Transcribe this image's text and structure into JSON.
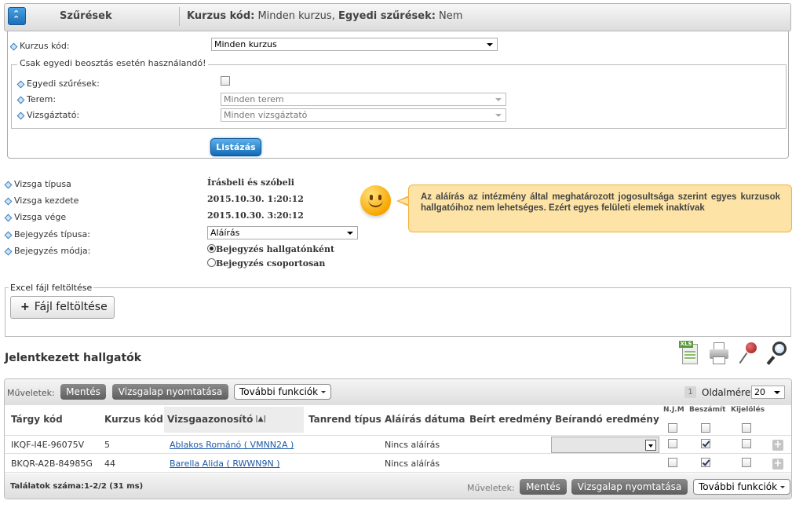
{
  "filter_header": {
    "title": "Szűrések",
    "summary_key1": "Kurzus kód:",
    "summary_val1": " Minden kurzus, ",
    "summary_key2": "Egyedi szűrések:",
    "summary_val2": " Nem"
  },
  "filters": {
    "kurzus_kod_label": "Kurzus kód:",
    "kurzus_kod_value": "Minden kurzus",
    "fieldset_legend": "Csak egyedi beosztás esetén használandó!",
    "egyedi_label": "Egyedi szűrések:",
    "terem_label": "Terem:",
    "terem_value": "Minden terem",
    "vizsgaztato_label": "Vizsgáztató:",
    "vizsgaztato_value": "Minden vizsgáztató",
    "list_button": "Listázás"
  },
  "exam": {
    "tipus_label": "Vizsga típusa",
    "tipus_value": "Írásbeli és szóbeli",
    "kezdete_label": "Vizsga kezdete",
    "kezdete_value": "2015.10.30. 1:20:12",
    "vege_label": "Vizsga vége",
    "vege_value": "2015.10.30. 3:20:12",
    "bejegyzes_tipus_label": "Bejegyzés típusa:",
    "bejegyzes_tipus_value": "Aláírás",
    "bejegyzes_mod_label": "Bejegyzés módja:",
    "radio1": "Bejegyzés hallgatónként",
    "radio2": "Bejegyzés csoportosan"
  },
  "notice": {
    "text": "Az aláírás az intézmény által meghatározott jogosultsága szerint egyes kurzusok hallgatóihoz nem lehetséges. Ezért egyes felületi elemek inaktívak"
  },
  "upload": {
    "legend": "Excel fájl feltöltése",
    "button": "Fájl feltöltése"
  },
  "students": {
    "title": "Jelentkezett hallgatók",
    "ops_label": "Műveletek:",
    "save": "Mentés",
    "print": "Vizsgalap nyomtatása",
    "more": "További funkciók",
    "page_num": "1",
    "page_size_label": "Oldalméret",
    "page_size": "20",
    "columns": {
      "targy": "Tárgy kód",
      "kurzus": "Kurzus kód",
      "vizsga_az": "Vizsgaazonosító",
      "tanrend": "Tanrend típus",
      "alairas": "Aláírás dátuma",
      "beirt": "Beírt eredmény",
      "beirando": "Beírandó eredmény",
      "njm": "N.J.M",
      "beszamit": "Beszámít",
      "kijeloles": "Kijelölés"
    },
    "rows": [
      {
        "targy": "IKQF-I4E-96075V",
        "kurzus": "5",
        "name": "Ablakos Románó ( VMNN2A )",
        "alairas": "Nincs aláírás"
      },
      {
        "targy": "BKQR-A2B-84985G",
        "kurzus": "44",
        "name": "Barella Alida ( RWWN9N )",
        "alairas": "Nincs aláírás"
      }
    ],
    "results": "Találatok száma:1-2/2 (31 ms)"
  }
}
